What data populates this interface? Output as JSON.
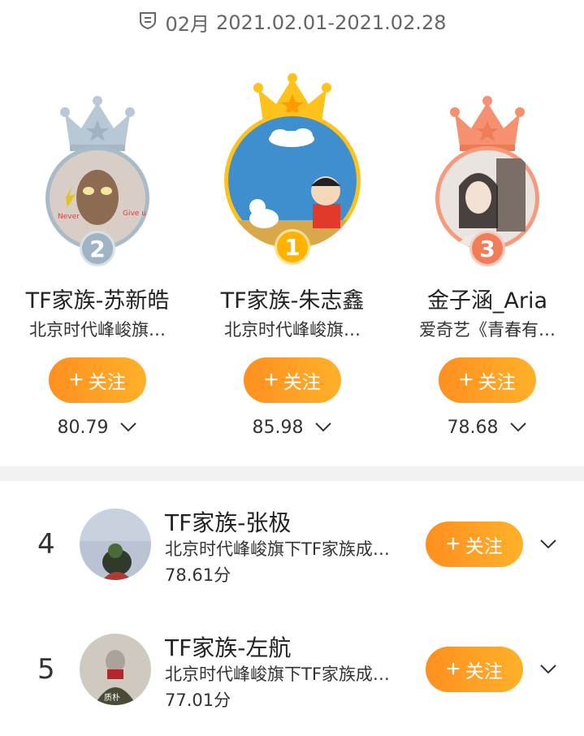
{
  "header": {
    "month": "02月",
    "range": "2021.02.01-2021.02.28",
    "icon": "shield-icon"
  },
  "podium": [
    {
      "rank": "2",
      "name": "TF家族-苏新皓",
      "desc": "北京时代峰峻旗…",
      "follow_label": "关注",
      "score": "80.79",
      "crown_color": "#b9c8d6",
      "badge_color": "#9fb3c4",
      "avatar_text_1": "Never",
      "avatar_text_2": "Give up"
    },
    {
      "rank": "1",
      "name": "TF家族-朱志鑫",
      "desc": "北京时代峰峻旗…",
      "follow_label": "关注",
      "score": "85.98",
      "crown_color": "#ffc21a",
      "badge_color": "#ffb300"
    },
    {
      "rank": "3",
      "name": "金子涵_Aria",
      "desc": "爱奇艺《青春有…",
      "follow_label": "关注",
      "score": "78.68",
      "crown_color": "#f59170",
      "badge_color": "#ef7d58"
    }
  ],
  "list": [
    {
      "rank": "4",
      "name": "TF家族-张极",
      "desc": "北京时代峰峻旗下TF家族成…",
      "score": "78.61分",
      "follow_label": "关注"
    },
    {
      "rank": "5",
      "name": "TF家族-左航",
      "desc": "北京时代峰峻旗下TF家族成…",
      "score": "77.01分",
      "follow_label": "关注",
      "avatar_caption": "质朴"
    }
  ],
  "colors": {
    "accent_start": "#ff8f1f",
    "accent_end": "#ffb12a",
    "divider": "#f2f2f2"
  }
}
